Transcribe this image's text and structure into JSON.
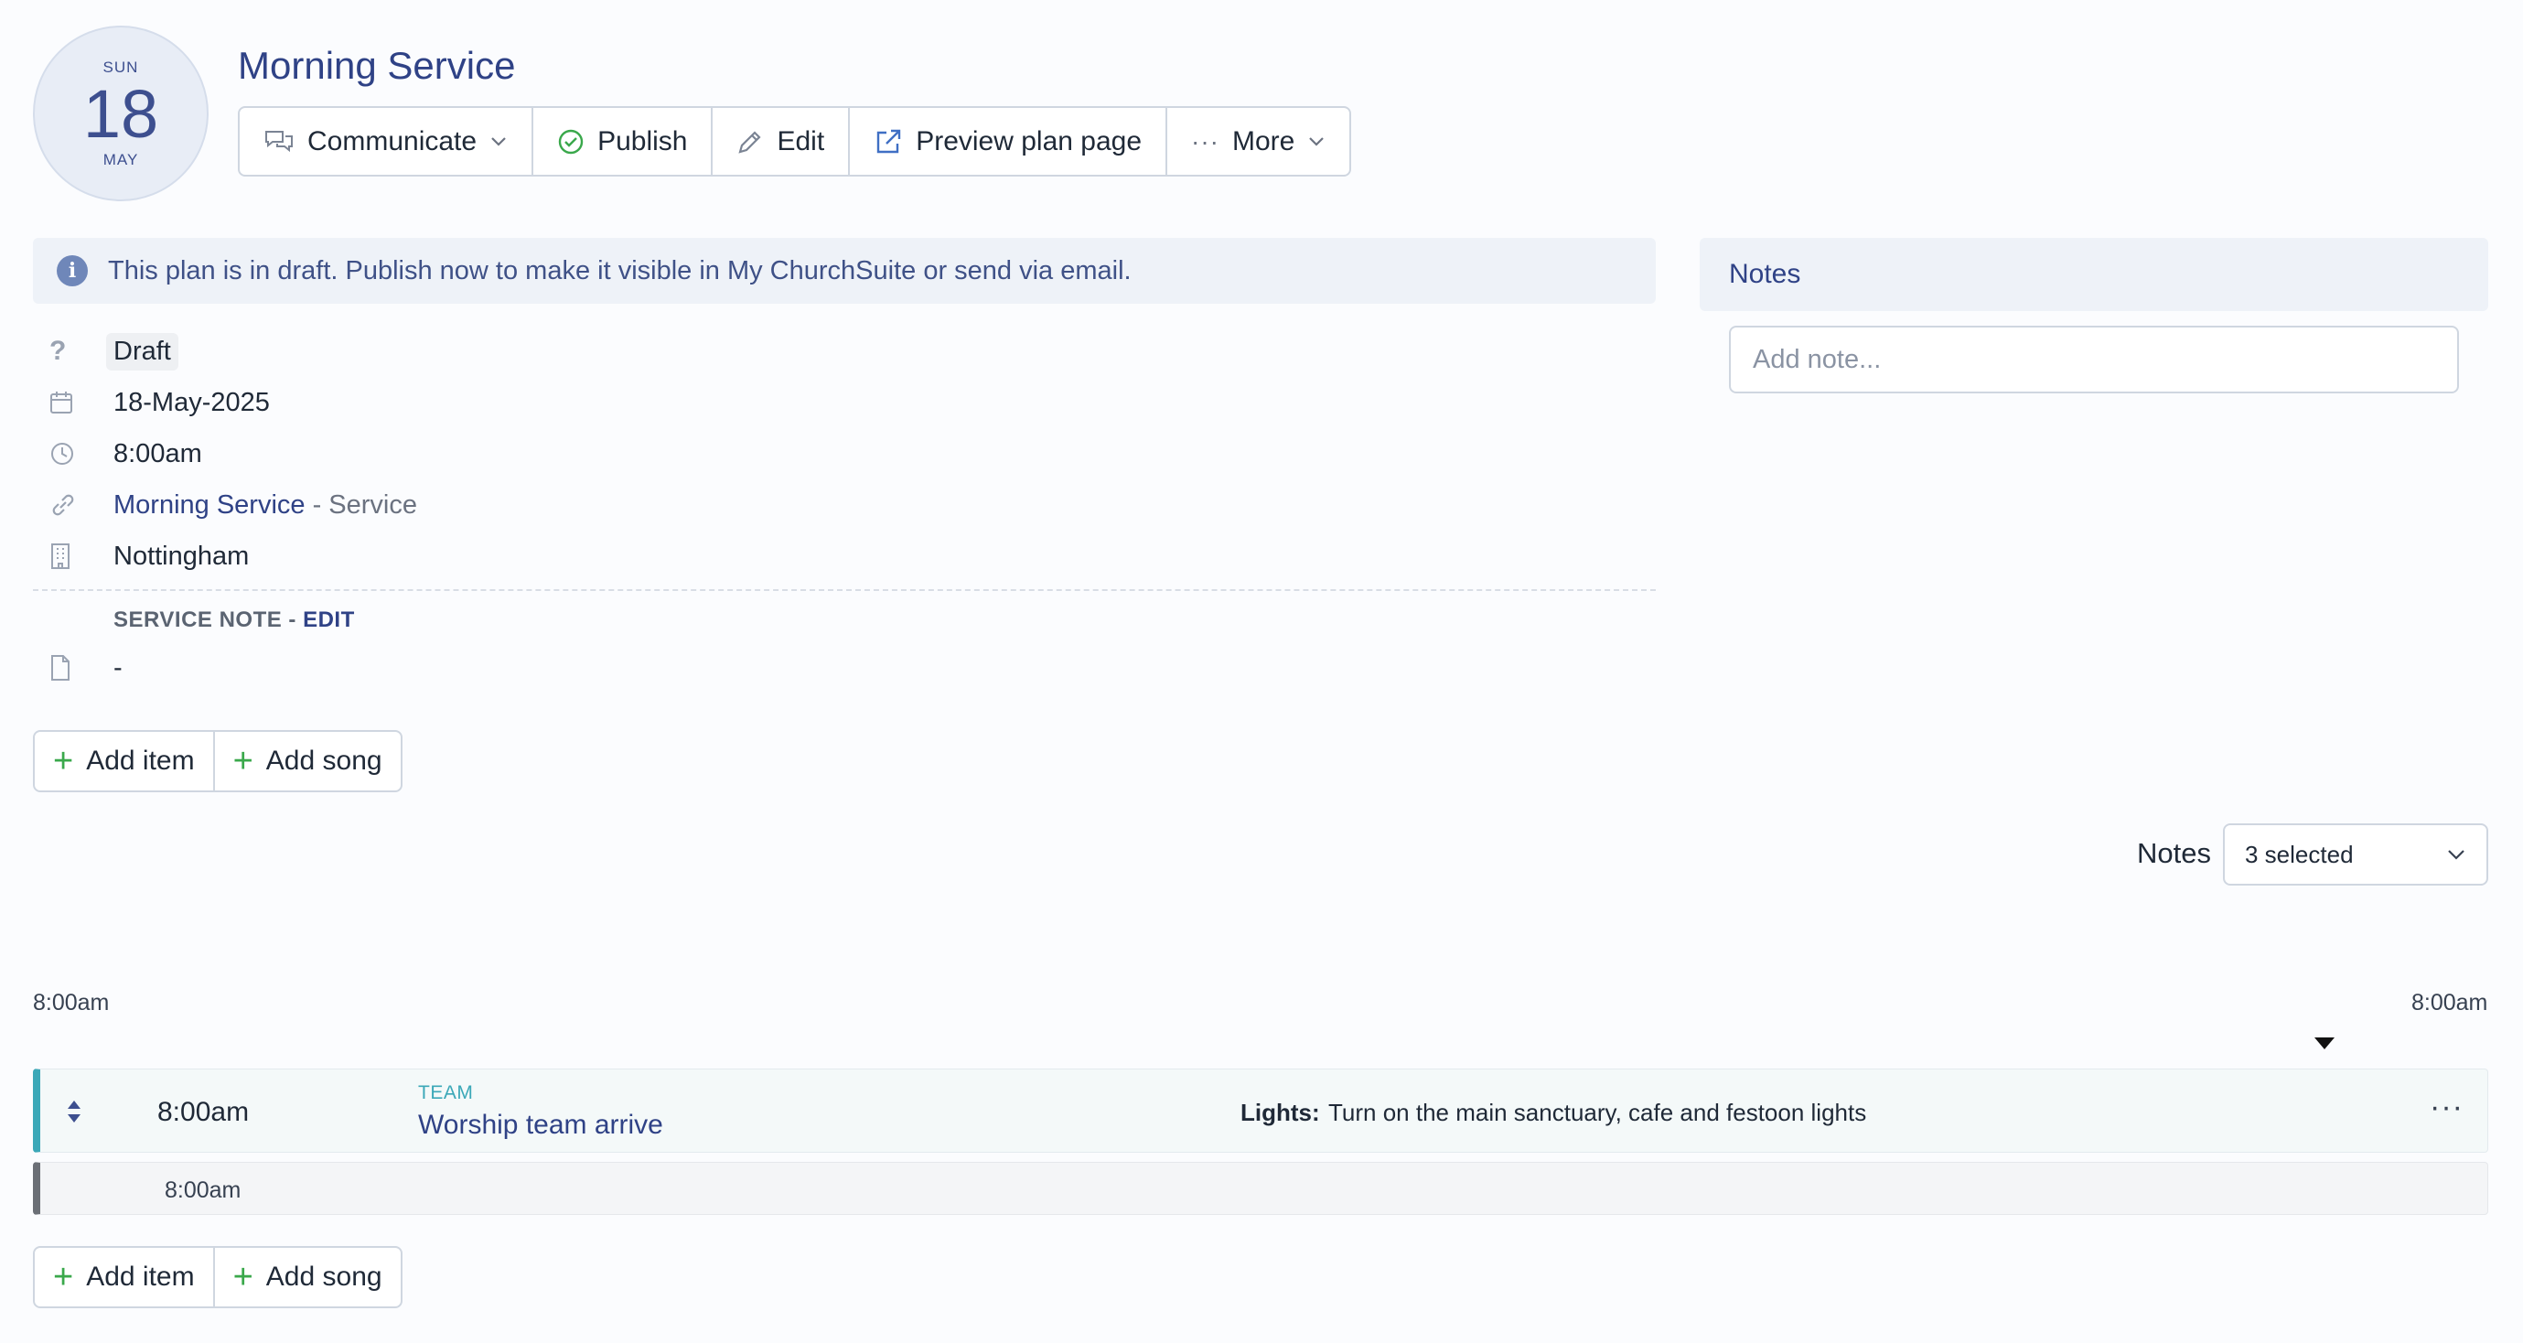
{
  "header": {
    "date": {
      "dow": "SUN",
      "day": "18",
      "month": "MAY"
    },
    "title": "Morning Service"
  },
  "toolbar": {
    "communicate": "Communicate",
    "publish": "Publish",
    "edit": "Edit",
    "preview": "Preview plan page",
    "more": "More"
  },
  "banner": {
    "text": "This plan is in draft. Publish now to make it visible in My ChurchSuite or send via email."
  },
  "details": {
    "status": "Draft",
    "date": "18-May-2025",
    "time": "8:00am",
    "service_link": "Morning Service",
    "service_type": " - Service",
    "site": "Nottingham",
    "service_note_label": "SERVICE NOTE - ",
    "service_note_edit": "EDIT",
    "service_note_value": "-"
  },
  "add_actions": {
    "add_item": "Add item",
    "add_song": "Add song"
  },
  "notes_panel": {
    "title": "Notes",
    "placeholder": "Add note..."
  },
  "notes_filter": {
    "label": "Notes",
    "selected": "3 selected"
  },
  "timeline": {
    "start_time": "8:00am",
    "end_time": "8:00am",
    "items": [
      {
        "time": "8:00am",
        "type": "TEAM",
        "title": "Worship team arrive",
        "note_label": "Lights:",
        "note_text": "Turn on the main sanctuary, cafe and festoon lights",
        "more": "···"
      }
    ],
    "end_marker_time": "8:00am"
  },
  "colors": {
    "brand": "#2f4286",
    "team_accent": "#3ba8b8",
    "success": "#3aa84b"
  }
}
